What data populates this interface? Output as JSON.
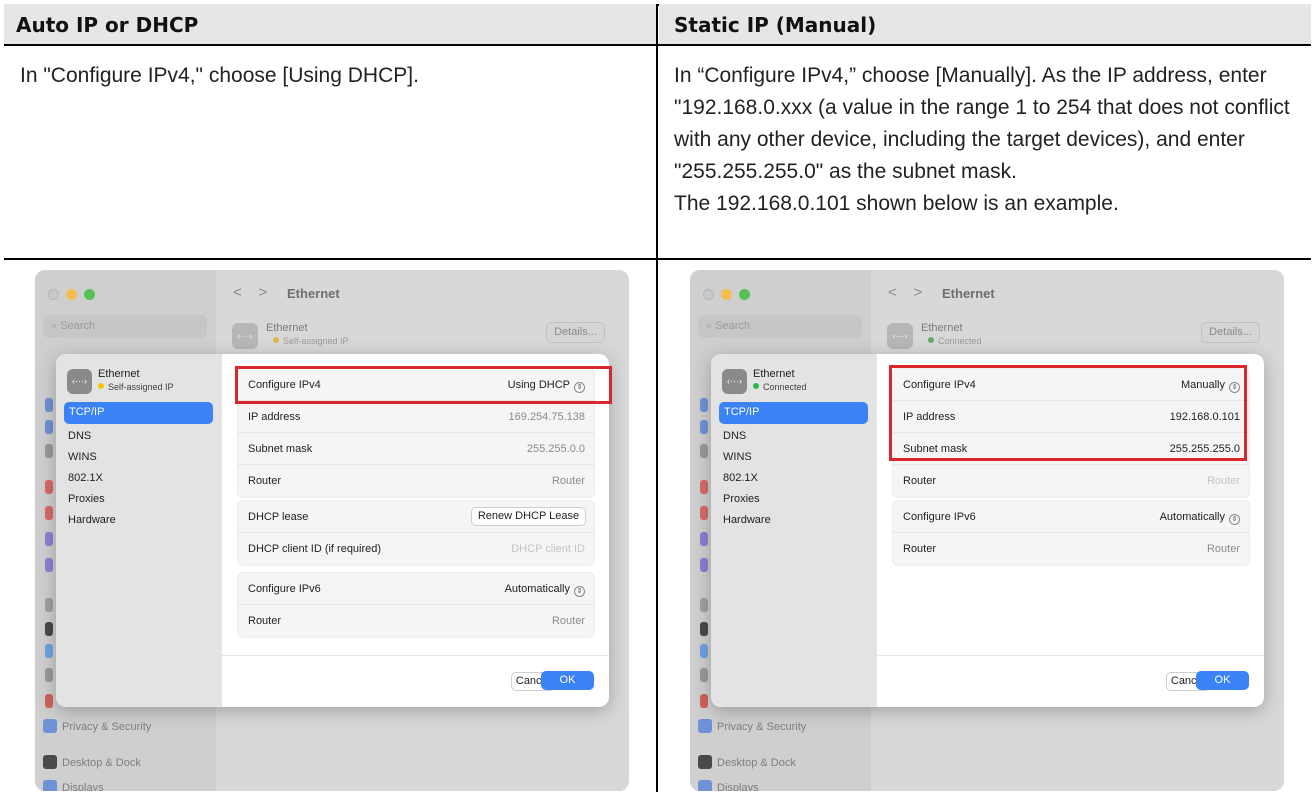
{
  "columns": {
    "left_header": "Auto IP or DHCP",
    "right_header": "Static IP (Manual)",
    "left_desc": "In \"Configure IPv4,\" choose [Using DHCP].",
    "right_desc": "In “Configure IPv4,” choose [Manually]. As the IP address, enter \"192.168.0.xxx (a value in the range 1 to 254 that does not conflict with any other device, including the target devices), and enter \"255.255.255.0\" as the subnet mask.",
    "right_note": "The 192.168.0.101 shown below is an example."
  },
  "window": {
    "nav_back": "<",
    "nav_forward": ">",
    "title": "Ethernet",
    "search_placeholder": "Search",
    "service_name": "Ethernet",
    "details_button": "Details...",
    "sidebar_below": [
      "Privacy & Security",
      "Desktop & Dock",
      "Displays"
    ],
    "icon_glyph": "‹···›"
  },
  "dialog": {
    "tabs": [
      "TCP/IP",
      "DNS",
      "WINS",
      "802.1X",
      "Proxies",
      "Hardware"
    ],
    "cancel": "Cancel",
    "ok": "OK"
  },
  "left": {
    "status": "Self-assigned IP",
    "status_color": "#f5c400",
    "configure_ipv4_label": "Configure IPv4",
    "configure_ipv4_value": "Using DHCP",
    "ip_label": "IP address",
    "ip_value": "169.254.75.138",
    "subnet_label": "Subnet mask",
    "subnet_value": "255.255.0.0",
    "router_label": "Router",
    "router_value": "Router",
    "dhcp_lease_label": "DHCP lease",
    "renew_button": "Renew DHCP Lease",
    "client_id_label": "DHCP client ID (if required)",
    "client_id_placeholder": "DHCP client ID",
    "ipv6_label": "Configure IPv6",
    "ipv6_value": "Automatically",
    "router6_label": "Router",
    "router6_value": "Router"
  },
  "right": {
    "status": "Connected",
    "status_color": "#2db84d",
    "configure_ipv4_label": "Configure IPv4",
    "configure_ipv4_value": "Manually",
    "ip_label": "IP address",
    "ip_value": "192.168.0.101",
    "subnet_label": "Subnet mask",
    "subnet_value": "255.255.255.0",
    "router_label": "Router",
    "router_value": "Router",
    "ipv6_label": "Configure IPv6",
    "ipv6_value": "Automatically",
    "router6_label": "Router",
    "router6_value": "Router"
  },
  "colors": {
    "accent": "#3a82f6",
    "highlight": "#d9282b",
    "header_bg": "#e6e6e6"
  }
}
